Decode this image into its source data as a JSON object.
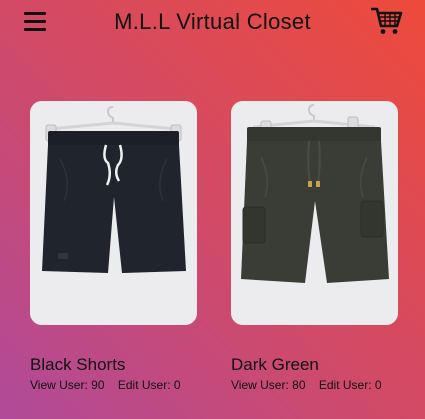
{
  "app": {
    "title": "M.L.L Virtual Closet",
    "menu_icon": "hamburger-menu-icon",
    "cart_icon": "shopping-cart-icon"
  },
  "colors": {
    "gradient_start": "#b04a9a",
    "gradient_end": "#ee4a3a",
    "card_background": "#ececee"
  },
  "items": [
    {
      "name": "Black Shorts",
      "view_label": "View User:",
      "view_value": "90",
      "edit_label": "Edit User:",
      "edit_value": "0",
      "garment_color": "#20252d"
    },
    {
      "name": "Dark Green",
      "view_label": "View User:",
      "view_value": "80",
      "edit_label": "Edit User:",
      "edit_value": "0",
      "garment_color": "#3a3d36"
    }
  ]
}
